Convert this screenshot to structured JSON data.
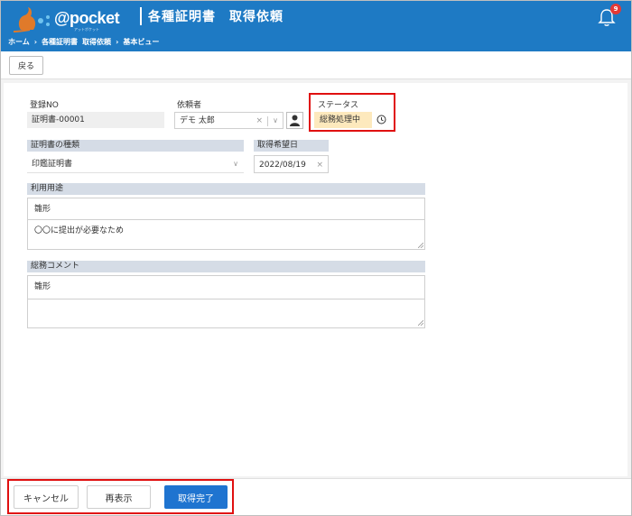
{
  "header": {
    "logo_text": "@pocket",
    "logo_sub": "アットポケット",
    "title": "各種証明書　取得依頼",
    "breadcrumb": [
      "ホーム",
      "各種証明書",
      "取得依頼",
      "基本ビュー"
    ],
    "notification_count": "9",
    "brand_color": "#1e7ac4"
  },
  "toolbar": {
    "back_label": "戻る"
  },
  "form": {
    "reg_no": {
      "label": "登録NO",
      "value": "証明書-00001"
    },
    "requester": {
      "label": "依頼者",
      "value": "デモ 太郎"
    },
    "status": {
      "label": "ステータス",
      "value": "総務処理中"
    },
    "cert_type": {
      "label": "証明書の種類",
      "value": "印鑑証明書"
    },
    "desired_date": {
      "label": "取得希望日",
      "value": "2022/08/19"
    },
    "usage": {
      "label": "利用用途",
      "line1": "雛形",
      "line2": "〇〇に提出が必要なため"
    },
    "comment": {
      "label": "総務コメント",
      "line1": "雛形",
      "line2": ""
    }
  },
  "footer": {
    "cancel_label": "キャンセル",
    "redisplay_label": "再表示",
    "complete_label": "取得完了",
    "primary_color": "#1f74d0"
  }
}
